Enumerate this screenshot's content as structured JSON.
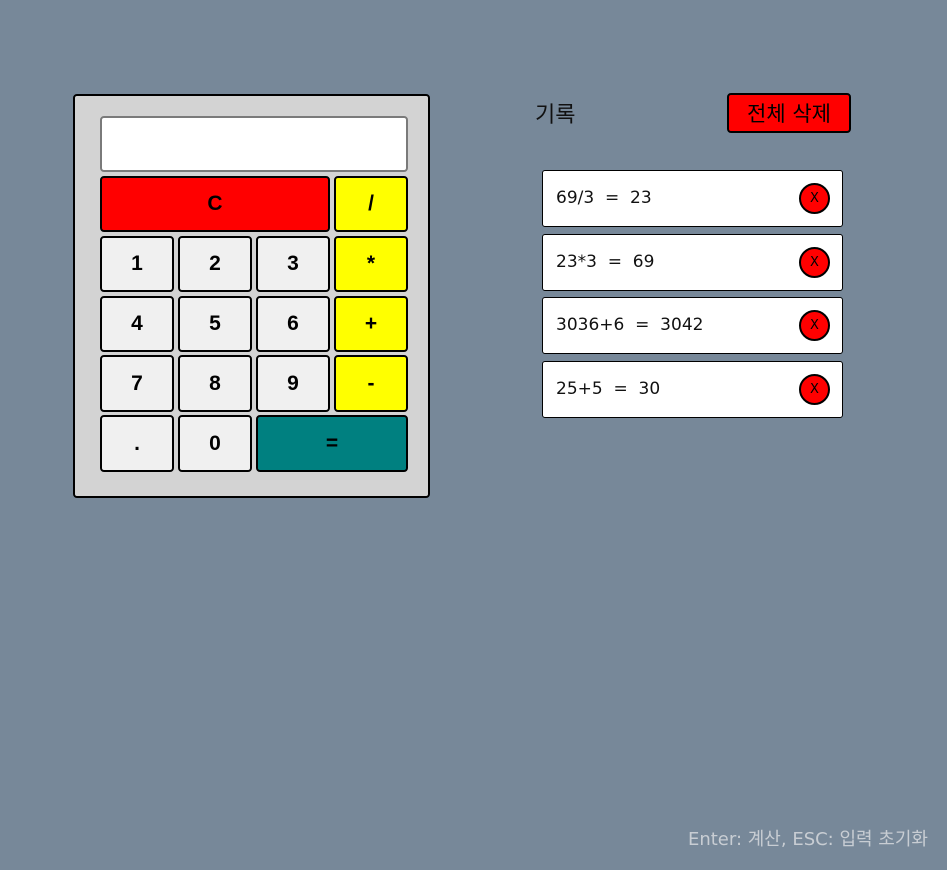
{
  "calculator": {
    "display_value": "",
    "buttons": {
      "clear": "C",
      "divide": "/",
      "one": "1",
      "two": "2",
      "three": "3",
      "multiply": "*",
      "four": "4",
      "five": "5",
      "six": "6",
      "plus": "+",
      "seven": "7",
      "eight": "8",
      "nine": "9",
      "minus": "-",
      "dot": ".",
      "zero": "0",
      "equals": "="
    }
  },
  "history": {
    "title": "기록",
    "clear_all_label": "전체 삭제",
    "delete_label": "X",
    "items": [
      {
        "expression": "69/3  =  23"
      },
      {
        "expression": "23*3  =  69"
      },
      {
        "expression": "3036+6  =  3042"
      },
      {
        "expression": "25+5  =  30"
      }
    ]
  },
  "hint": "Enter: 계산, ESC: 입력 초기화",
  "colors": {
    "background": "#778899",
    "calculator_body": "#d3d3d3",
    "clear_button": "#ff0000",
    "operator_button": "#ffff00",
    "equals_button": "#008080",
    "number_button": "#f0f0f0"
  }
}
